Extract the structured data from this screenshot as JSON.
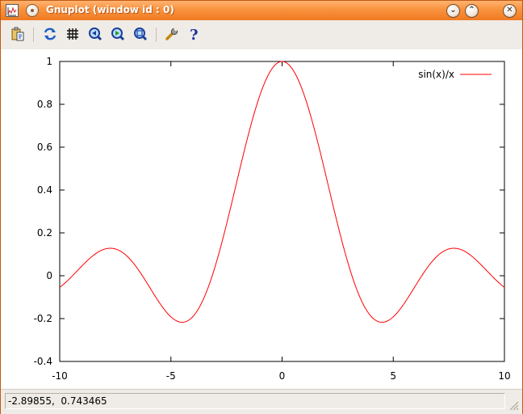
{
  "window": {
    "title": "Gnuplot (window id : 0)",
    "accent_color": "#f08a35"
  },
  "titlebar_buttons": [
    {
      "name": "minimize",
      "glyph": "⌄"
    },
    {
      "name": "maximize",
      "glyph": "⌃"
    },
    {
      "name": "close",
      "glyph": "✕"
    }
  ],
  "toolbar": {
    "items": [
      {
        "name": "copy-to-clipboard-icon"
      },
      {
        "name": "replot-icon"
      },
      {
        "name": "toggle-grid-icon"
      },
      {
        "name": "previous-zoom-icon"
      },
      {
        "name": "next-zoom-icon"
      },
      {
        "name": "autoscale-icon"
      },
      {
        "name": "options-wrench-icon"
      },
      {
        "name": "help-icon"
      }
    ]
  },
  "chart_data": {
    "type": "line",
    "function": "sin(x)/x",
    "legend": {
      "label": "sin(x)/x",
      "position": "top-right"
    },
    "series": [
      {
        "name": "sin(x)/x",
        "color": "#ff0000",
        "x": [
          -10,
          -9.5,
          -9,
          -8.5,
          -8,
          -7.5,
          -7,
          -6.5,
          -6,
          -5.5,
          -5,
          -4.5,
          -4,
          -3.5,
          -3,
          -2.5,
          -2,
          -1.5,
          -1,
          -0.5,
          0,
          0.5,
          1,
          1.5,
          2,
          2.5,
          3,
          3.5,
          4,
          4.5,
          5,
          5.5,
          6,
          6.5,
          7,
          7.5,
          8,
          8.5,
          9,
          9.5,
          10
        ],
        "y": [
          -0.054,
          -0.007,
          0.046,
          0.094,
          0.124,
          0.125,
          0.094,
          0.033,
          -0.047,
          -0.128,
          -0.192,
          -0.217,
          -0.189,
          -0.1,
          0.047,
          0.239,
          0.455,
          0.665,
          0.841,
          0.959,
          1.0,
          0.959,
          0.841,
          0.665,
          0.455,
          0.239,
          0.047,
          -0.1,
          -0.189,
          -0.217,
          -0.192,
          -0.128,
          -0.047,
          0.033,
          0.094,
          0.125,
          0.124,
          0.094,
          0.046,
          -0.007,
          -0.054
        ]
      }
    ],
    "xlim": [
      -10,
      10
    ],
    "ylim": [
      -0.4,
      1
    ],
    "xticks": [
      -10,
      -5,
      0,
      5,
      10
    ],
    "xtick_labels": [
      "-10",
      "-5",
      "0",
      "5",
      "10"
    ],
    "yticks": [
      -0.4,
      -0.2,
      0,
      0.2,
      0.4,
      0.6,
      0.8,
      1
    ],
    "ytick_labels": [
      "-0.4",
      "-0.2",
      "0",
      "0.2",
      "0.4",
      "0.6",
      "0.8",
      "1"
    ],
    "grid": false,
    "title": "",
    "xlabel": "",
    "ylabel": ""
  },
  "status_bar": {
    "coordinates": "-2.89855,  0.743465"
  }
}
